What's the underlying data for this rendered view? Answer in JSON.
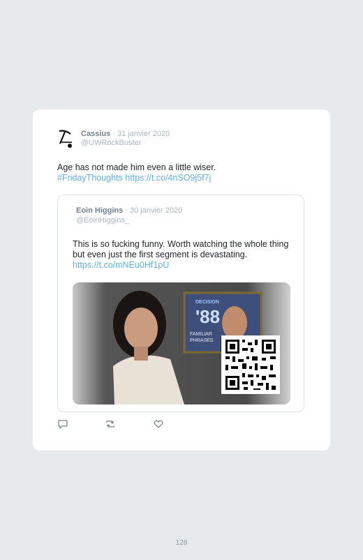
{
  "tweet": {
    "author_name": "Cassius",
    "date": "· 31 janvier 2020",
    "handle": "@UWRockBuster",
    "text": "Age has not made him even a little wiser.",
    "hashtag": "#FridayThoughts",
    "link": "https://t.co/4nSO9j5f7j"
  },
  "quoted_tweet": {
    "author_name": "Eoin Higgins",
    "date": "· 30 janvier 2020",
    "handle": "@EoinHiggins_",
    "text": "This is so fucking funny. Worth watching the whole thing but even just the first segment is devastating.",
    "link": "https://t.co/mNEu0Hf1pU",
    "media": {
      "type": "video-thumbnail",
      "overlay_lines": [
        "DECISION",
        "'88",
        "FAMILIAR",
        "PHRASES"
      ]
    }
  },
  "actions": [
    {
      "name": "reply-icon"
    },
    {
      "name": "retweet-icon"
    },
    {
      "name": "like-icon"
    }
  ],
  "page_number": "128",
  "colors": {
    "background": "#e6eaed",
    "card": "#ffffff",
    "link": "#62b0e5",
    "muted": "#aab6c1",
    "text": "#1f2328"
  }
}
